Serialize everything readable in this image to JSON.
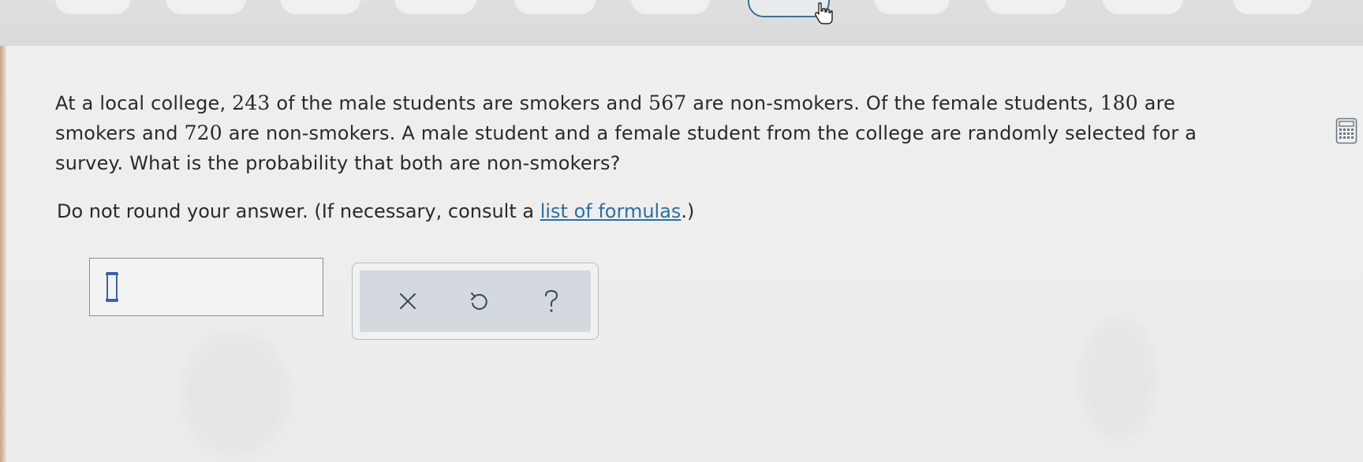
{
  "progress": {
    "pills": [
      "",
      "",
      "",
      "",
      "",
      "",
      "",
      "",
      "",
      "",
      ""
    ],
    "active_index": 6
  },
  "question": {
    "seg1": "At a local college, ",
    "male_smokers": "243",
    "seg2": " of the male students are smokers and ",
    "male_nonsmokers": "567",
    "seg3": " are non-smokers. Of the female students, ",
    "female_smokers": "180",
    "seg4": " are smokers and ",
    "female_nonsmokers": "720",
    "seg5": " are non-smokers. A male student and a female student from the college are randomly selected for a survey. What is the probability that both are non-smokers?"
  },
  "instruction": {
    "prefix": "Do not round your answer. (If necessary, consult a ",
    "link": "list of formulas",
    "suffix": ".)"
  },
  "answer": {
    "value": ""
  },
  "tools": {
    "clear_icon": "close-icon",
    "undo_icon": "undo-icon",
    "help_icon": "help-icon"
  },
  "colors": {
    "link": "#2d6f9e",
    "tool_tray": "#d3d9de",
    "cursor": "#3d62a8"
  }
}
